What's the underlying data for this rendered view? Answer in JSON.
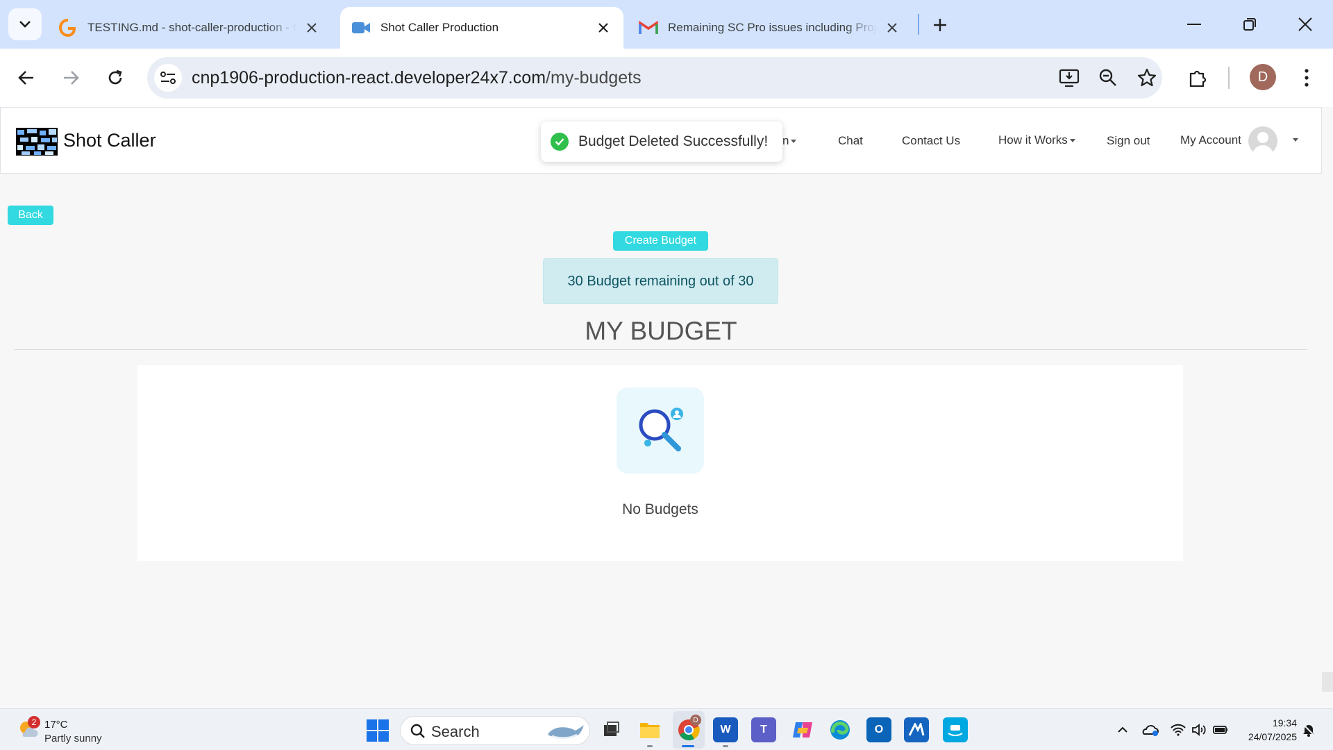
{
  "browser": {
    "tabs": [
      {
        "title": "TESTING.md - shot-caller-production - Git",
        "favicon": "gitlab-orange-icon",
        "active": false
      },
      {
        "title": "Shot Caller Production",
        "favicon": "video-camera-icon",
        "active": true
      },
      {
        "title": "Remaining SC Pro issues including Project",
        "favicon": "gmail-icon",
        "active": false
      }
    ],
    "url_host": "cnp1906-production-react.developer24x7.com",
    "url_path": "/my-budgets",
    "profile_initial": "D"
  },
  "site": {
    "brand": "Shot Caller",
    "nav": {
      "partial_label": "n",
      "chat": "Chat",
      "contact": "Contact Us",
      "how_it_works": "How it Works",
      "sign_out": "Sign out",
      "my_account": "My Account"
    },
    "toast": "Budget Deleted Successfully!",
    "back_label": "Back",
    "create_label": "Create Budget",
    "remaining_text": "30 Budget remaining out of 30",
    "heading": "MY BUDGET",
    "empty_text": "No Budgets"
  },
  "taskbar": {
    "weather_badge": "2",
    "temperature": "17°C",
    "condition": "Partly sunny",
    "search_label": "Search",
    "chrome_badge": "D",
    "time": "19:34",
    "date": "24/07/2025"
  },
  "colors": {
    "accent": "#32d9e0",
    "info_bg": "#d1ecf1",
    "info_text": "#0c5460",
    "chrome_tabstrip": "#d3e3fd",
    "success": "#2fbf4a"
  }
}
